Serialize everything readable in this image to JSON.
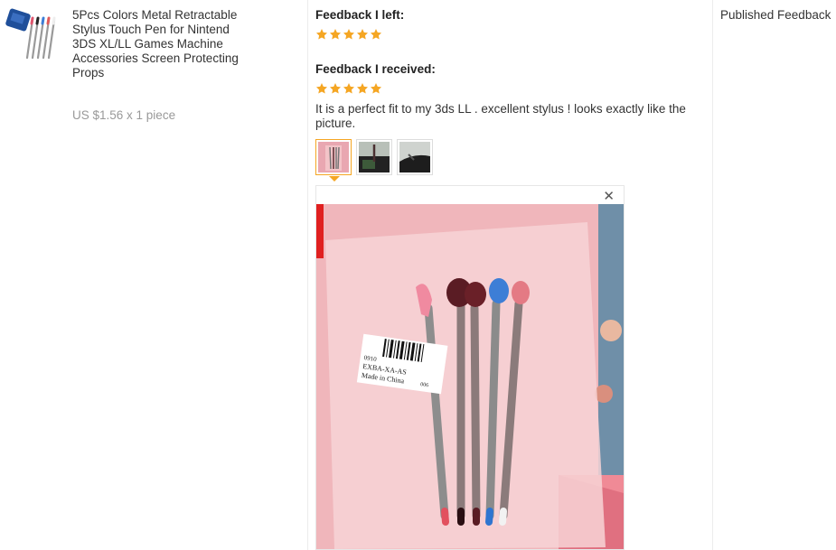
{
  "product": {
    "title": "5Pcs Colors Metal Retractable Stylus Touch Pen for Nintend 3DS XL/LL Games Machine Accessories Screen Protecting Props",
    "price": "US $1.56 x 1 piece",
    "thumbnail_icon": "product-stylus-image"
  },
  "feedback": {
    "left_heading": "Feedback I left:",
    "left_rating": 5,
    "received_heading": "Feedback I received:",
    "received_rating": 5,
    "comment": "It is a perfect fit to my 3ds LL . excellent stylus ! looks exactly like the picture.",
    "photos": [
      {
        "icon": "photo-thumb-stylus-package",
        "selected": true
      },
      {
        "icon": "photo-thumb-stylus-on-device",
        "selected": false
      },
      {
        "icon": "photo-thumb-stylus-in-slot",
        "selected": false
      }
    ],
    "viewer": {
      "close_icon": "close-icon",
      "photo_icon": "stylus-package-photo",
      "label_lines": [
        "0910",
        "EXBA-XA-AS",
        "Made in China"
      ],
      "label_side": "006"
    }
  },
  "status": {
    "label": "Published Feedback"
  },
  "colors": {
    "star": "#f5a623",
    "selected_border": "#f5a623",
    "price": "#999999"
  }
}
